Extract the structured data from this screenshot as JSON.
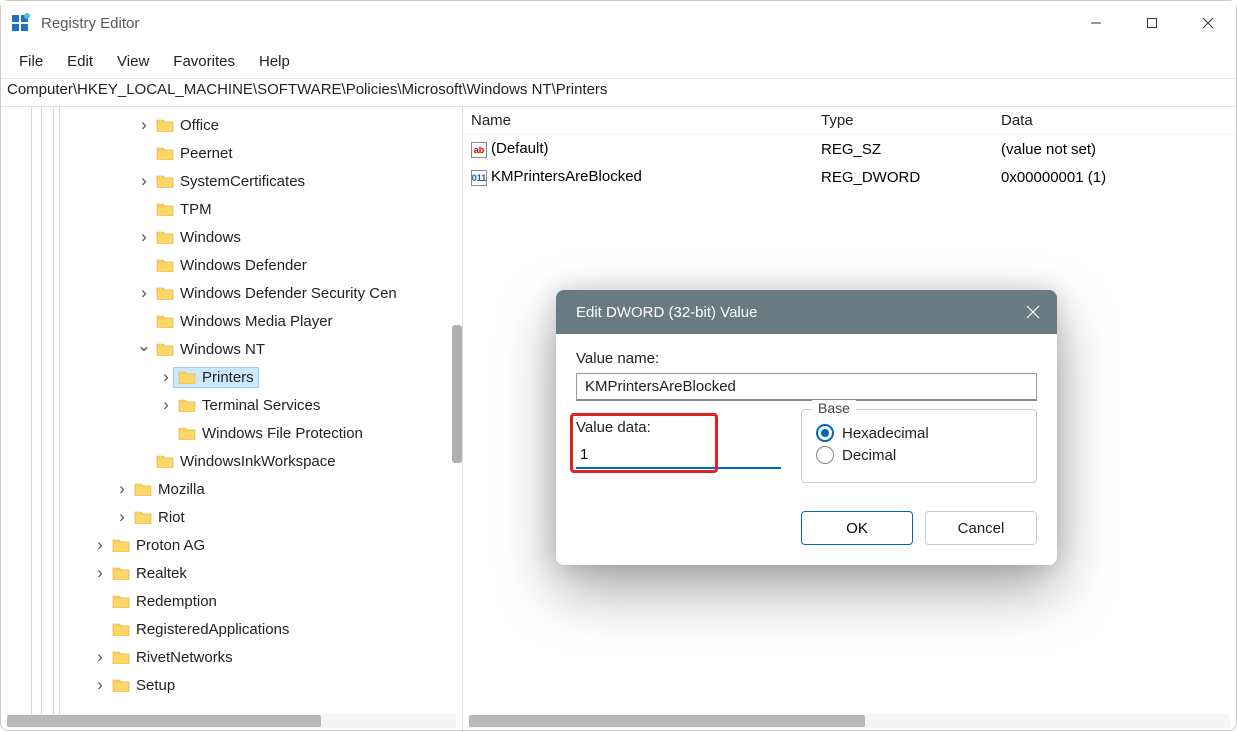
{
  "window": {
    "title": "Registry Editor"
  },
  "menu": {
    "file": "File",
    "edit": "Edit",
    "view": "View",
    "favorites": "Favorites",
    "help": "Help"
  },
  "address": "Computer\\HKEY_LOCAL_MACHINE\\SOFTWARE\\Policies\\Microsoft\\Windows NT\\Printers",
  "tree": [
    {
      "indent": 135,
      "chev": "right",
      "label": "Office"
    },
    {
      "indent": 135,
      "chev": "none",
      "label": "Peernet"
    },
    {
      "indent": 135,
      "chev": "right",
      "label": "SystemCertificates"
    },
    {
      "indent": 135,
      "chev": "none",
      "label": "TPM"
    },
    {
      "indent": 135,
      "chev": "right",
      "label": "Windows"
    },
    {
      "indent": 135,
      "chev": "none",
      "label": "Windows Defender"
    },
    {
      "indent": 135,
      "chev": "right",
      "label": "Windows Defender Security Cen"
    },
    {
      "indent": 135,
      "chev": "none",
      "label": "Windows Media Player"
    },
    {
      "indent": 135,
      "chev": "down",
      "label": "Windows NT"
    },
    {
      "indent": 157,
      "chev": "right",
      "label": "Printers",
      "selected": true
    },
    {
      "indent": 157,
      "chev": "right",
      "label": "Terminal Services"
    },
    {
      "indent": 157,
      "chev": "none",
      "label": "Windows File Protection"
    },
    {
      "indent": 135,
      "chev": "none",
      "label": "WindowsInkWorkspace"
    },
    {
      "indent": 113,
      "chev": "right",
      "label": "Mozilla"
    },
    {
      "indent": 113,
      "chev": "right",
      "label": "Riot"
    },
    {
      "indent": 91,
      "chev": "right",
      "label": "Proton AG"
    },
    {
      "indent": 91,
      "chev": "right",
      "label": "Realtek"
    },
    {
      "indent": 91,
      "chev": "none",
      "label": "Redemption"
    },
    {
      "indent": 91,
      "chev": "none",
      "label": "RegisteredApplications"
    },
    {
      "indent": 91,
      "chev": "right",
      "label": "RivetNetworks"
    },
    {
      "indent": 91,
      "chev": "right",
      "label": "Setup"
    }
  ],
  "list": {
    "headers": {
      "name": "Name",
      "type": "Type",
      "data": "Data"
    },
    "rows": [
      {
        "icon": "sz",
        "iconText": "ab",
        "name": "(Default)",
        "type": "REG_SZ",
        "data": "(value not set)"
      },
      {
        "icon": "dw",
        "iconText": "011",
        "name": "KMPrintersAreBlocked",
        "type": "REG_DWORD",
        "data": "0x00000001 (1)"
      }
    ]
  },
  "dialog": {
    "title": "Edit DWORD (32-bit) Value",
    "valueNameLabel": "Value name:",
    "valueName": "KMPrintersAreBlocked",
    "valueDataLabel": "Value data:",
    "valueData": "1",
    "baseLabel": "Base",
    "hex": "Hexadecimal",
    "dec": "Decimal",
    "baseSelected": "hex",
    "ok": "OK",
    "cancel": "Cancel"
  }
}
